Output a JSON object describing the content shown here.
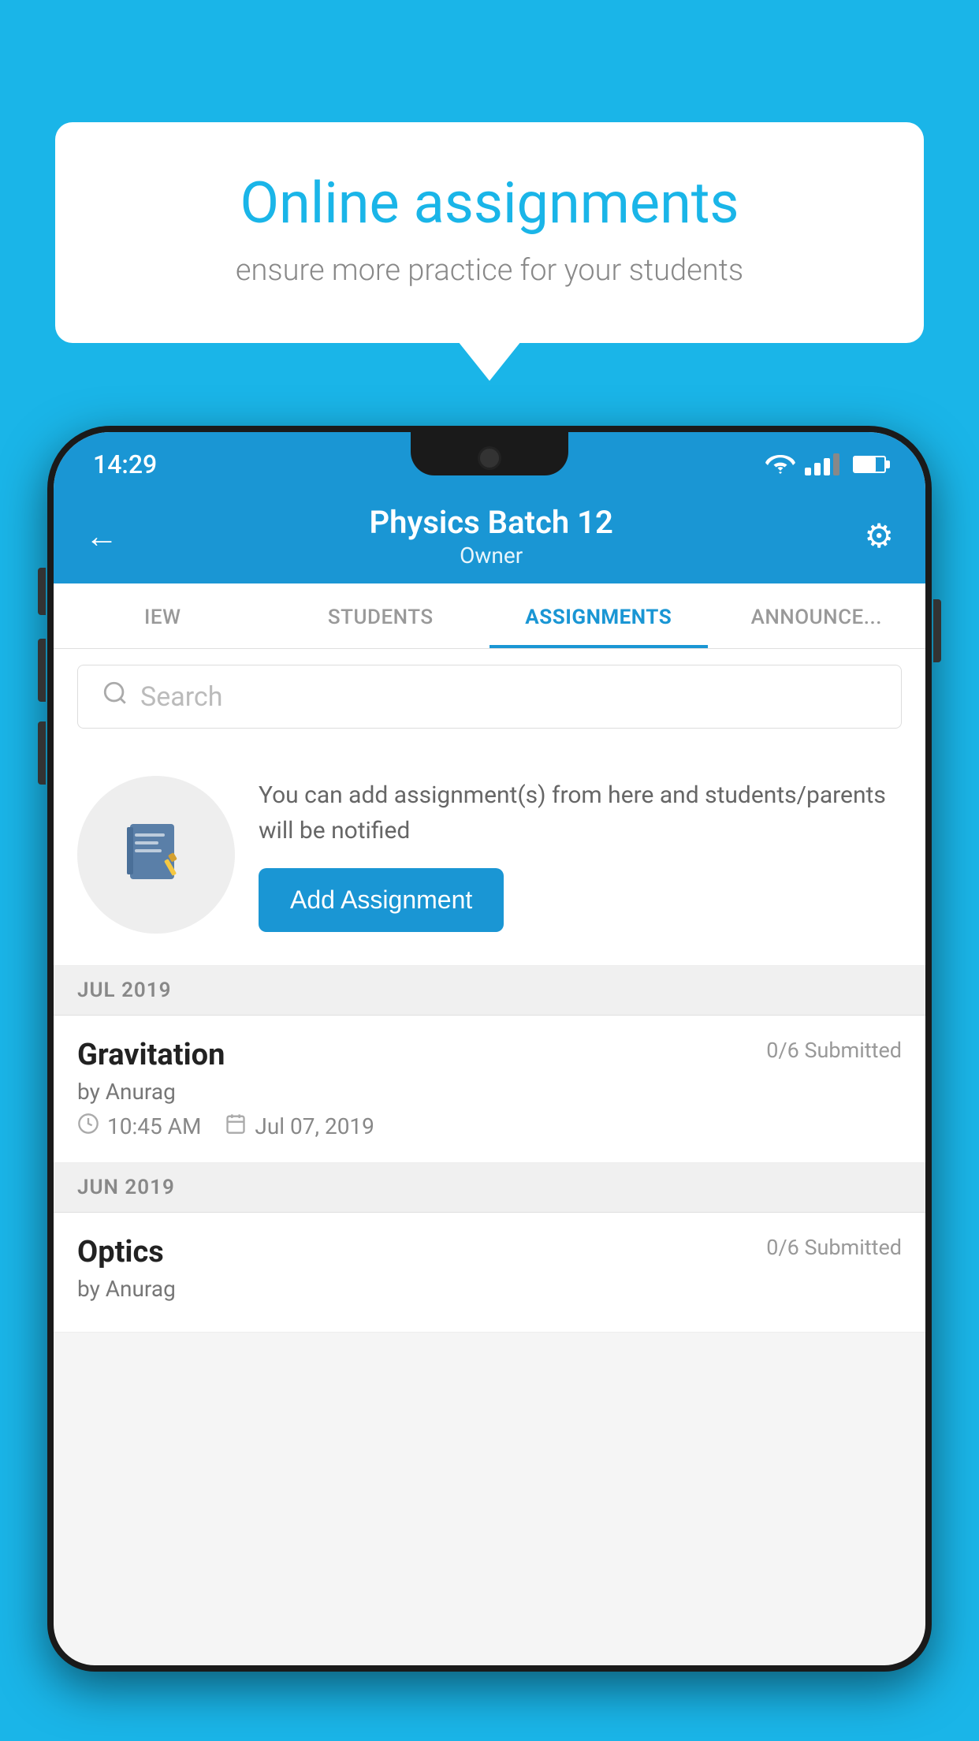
{
  "background_color": "#1ab5e8",
  "speech_bubble": {
    "title": "Online assignments",
    "subtitle": "ensure more practice for your students"
  },
  "phone": {
    "status_bar": {
      "time": "14:29"
    },
    "header": {
      "title": "Physics Batch 12",
      "subtitle": "Owner",
      "back_label": "←",
      "settings_label": "⚙"
    },
    "tabs": [
      {
        "label": "IEW",
        "active": false
      },
      {
        "label": "STUDENTS",
        "active": false
      },
      {
        "label": "ASSIGNMENTS",
        "active": true
      },
      {
        "label": "ANNOUNCEMENTS",
        "active": false
      }
    ],
    "search": {
      "placeholder": "Search"
    },
    "add_assignment_section": {
      "info_text": "You can add assignment(s) from here and students/parents will be notified",
      "button_label": "Add Assignment"
    },
    "sections": [
      {
        "month": "JUL 2019",
        "items": [
          {
            "name": "Gravitation",
            "submitted": "0/6 Submitted",
            "author": "by Anurag",
            "time": "10:45 AM",
            "date": "Jul 07, 2019"
          }
        ]
      },
      {
        "month": "JUN 2019",
        "items": [
          {
            "name": "Optics",
            "submitted": "0/6 Submitted",
            "author": "by Anurag",
            "time": "",
            "date": ""
          }
        ]
      }
    ]
  }
}
